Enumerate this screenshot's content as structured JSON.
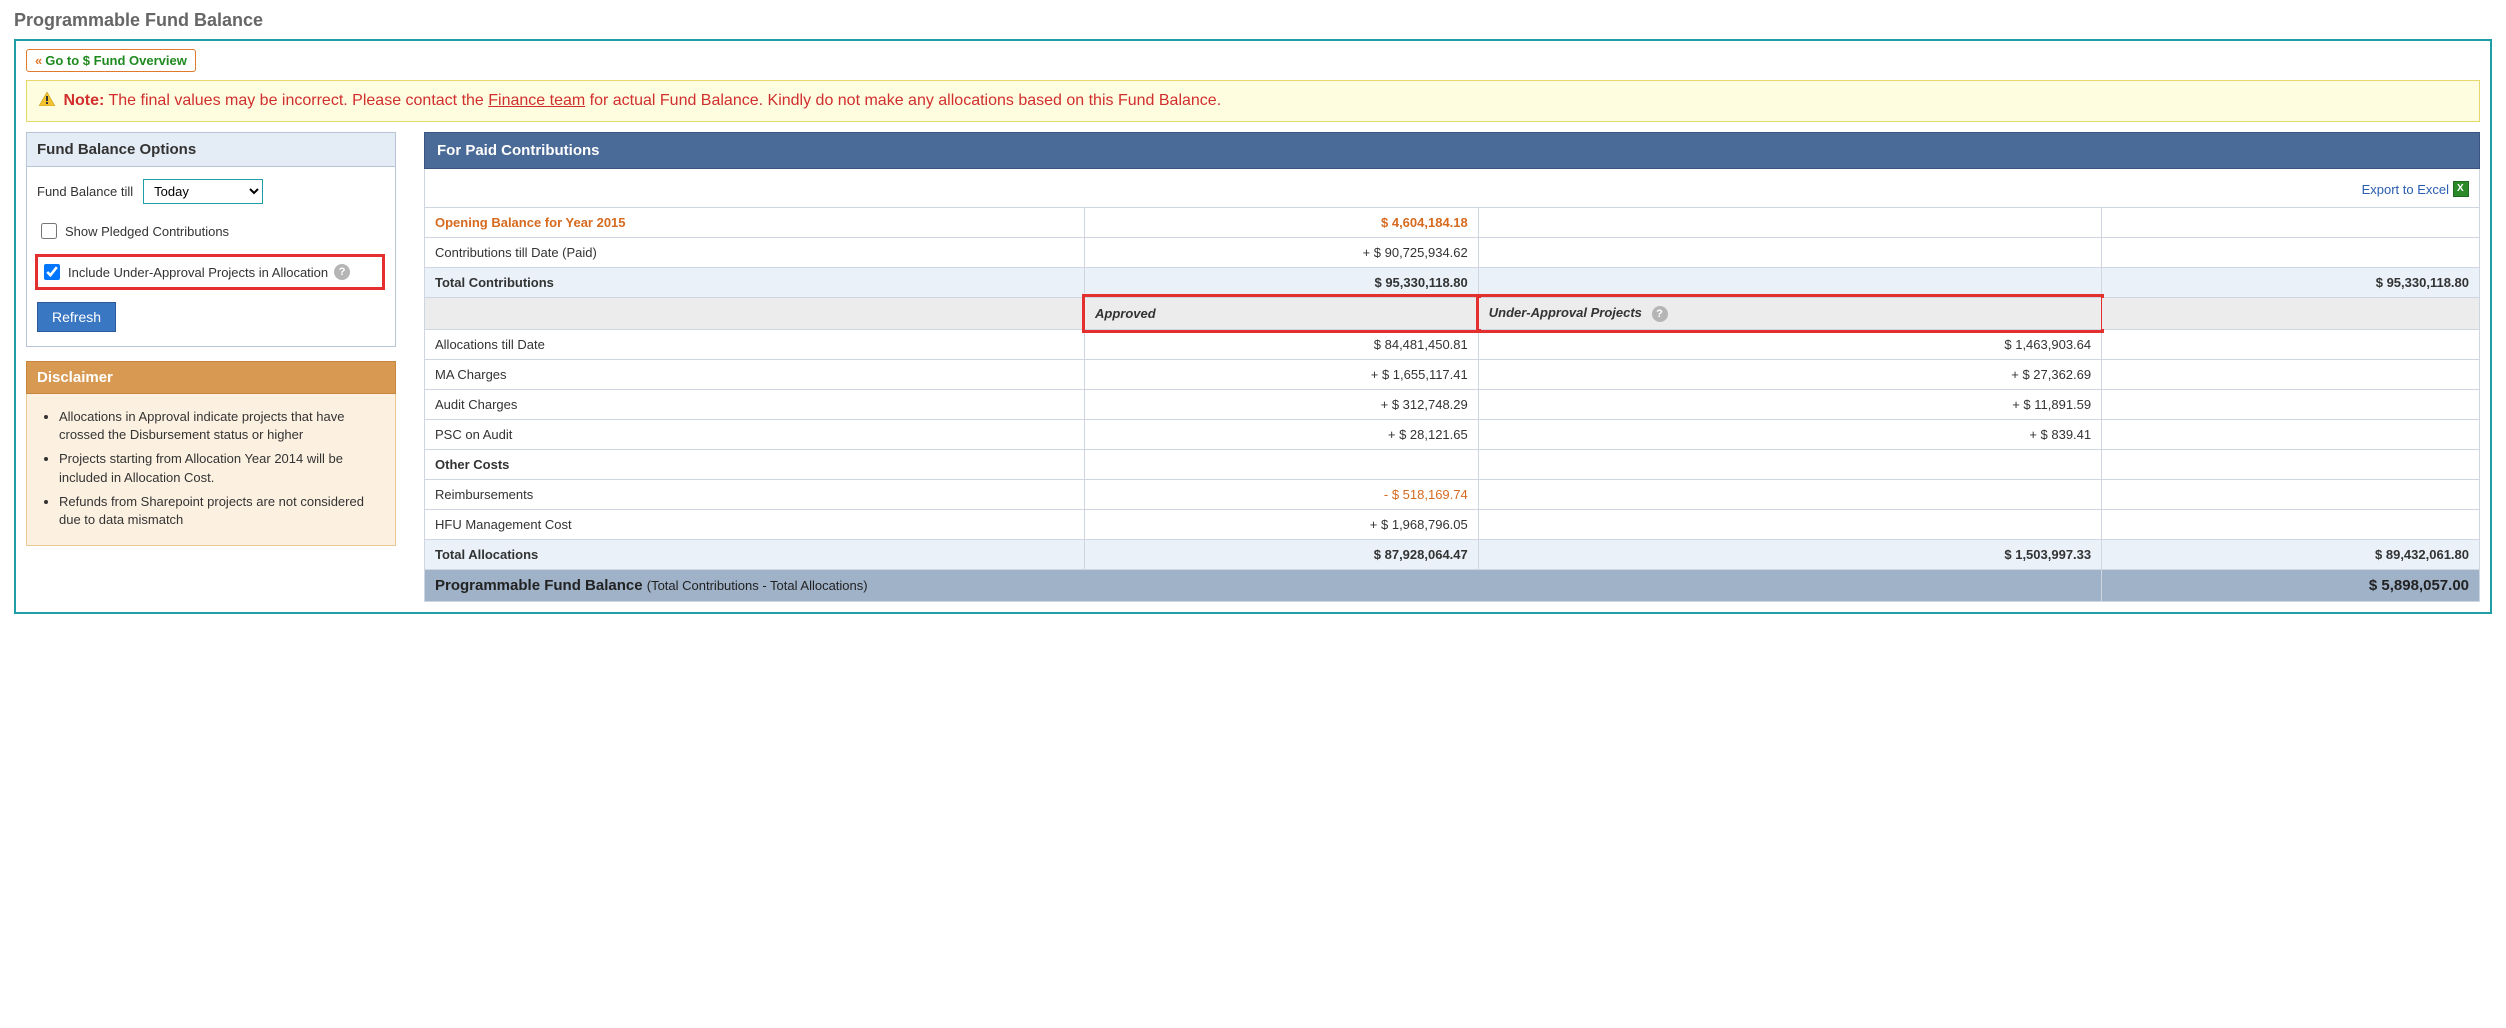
{
  "page_title": "Programmable Fund Balance",
  "back_link": "Go to $ Fund Overview",
  "note": {
    "label": "Note:",
    "text_before_link": "The final values may be incorrect. Please contact the ",
    "link_text": "Finance team",
    "text_after_link": " for actual Fund Balance. Kindly do not make any allocations based on this Fund Balance."
  },
  "options": {
    "panel_title": "Fund Balance Options",
    "till_label": "Fund Balance till",
    "till_value": "Today",
    "pledged_label": "Show Pledged Contributions",
    "pledged_checked": false,
    "under_approval_label": "Include Under-Approval Projects in Allocation",
    "under_approval_checked": true,
    "refresh_label": "Refresh"
  },
  "disclaimer": {
    "title": "Disclaimer",
    "items": [
      "Allocations in Approval indicate projects that have crossed the Disbursement status or higher",
      "Projects starting from Allocation Year 2014 will be included in Allocation Cost.",
      "Refunds from Sharepoint projects are not considered due to data mismatch"
    ]
  },
  "table": {
    "header": "For Paid Contributions",
    "export_label": "Export to Excel",
    "opening_label": "Opening Balance for Year 2015",
    "opening_value": "$ 4,604,184.18",
    "contrib_label": "Contributions till Date (Paid)",
    "contrib_value": "+ $ 90,725,934.62",
    "total_contrib_label": "Total Contributions",
    "total_contrib_approved": "$ 95,330,118.80",
    "total_contrib_grand": "$ 95,330,118.80",
    "col_approved": "Approved",
    "col_under": "Under-Approval Projects",
    "rows": [
      {
        "label": "Allocations till Date",
        "approved": "$ 84,481,450.81",
        "under": "$ 1,463,903.64"
      },
      {
        "label": "MA Charges",
        "approved": "+ $ 1,655,117.41",
        "under": "+ $ 27,362.69"
      },
      {
        "label": "Audit Charges",
        "approved": "+ $ 312,748.29",
        "under": "+ $ 11,891.59"
      },
      {
        "label": "PSC on Audit",
        "approved": "+ $ 28,121.65",
        "under": "+ $ 839.41"
      }
    ],
    "other_costs_label": "Other Costs",
    "reimb_label": "Reimbursements",
    "reimb_value": "- $ 518,169.74",
    "hfu_label": "HFU Management Cost",
    "hfu_value": "+ $ 1,968,796.05",
    "total_alloc_label": "Total Allocations",
    "total_alloc_approved": "$ 87,928,064.47",
    "total_alloc_under": "$ 1,503,997.33",
    "total_alloc_grand": "$ 89,432,061.80",
    "grand_label": "Programmable Fund Balance",
    "grand_sub": "(Total Contributions - Total Allocations)",
    "grand_value": "$ 5,898,057.00"
  }
}
